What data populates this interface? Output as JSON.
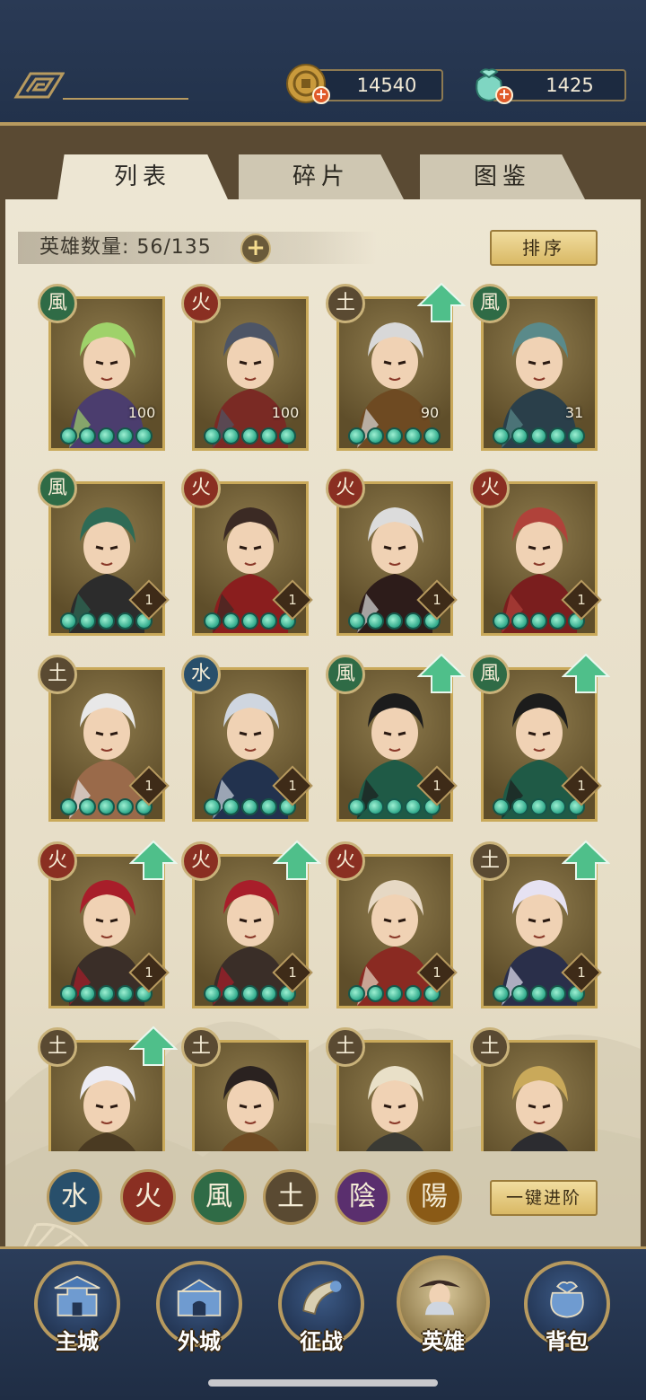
{
  "currency": {
    "coins": "14540",
    "jade": "1425"
  },
  "tabs": [
    {
      "label": "列表",
      "active": true
    },
    {
      "label": "碎片",
      "active": false
    },
    {
      "label": "图鉴",
      "active": false
    }
  ],
  "hero_count_label": "英雄数量: 56/135",
  "sort_button": "排序",
  "advance_button": "一键进阶",
  "heroes": [
    {
      "element": "風",
      "level": "100",
      "level_style": "plain",
      "upgrade": false,
      "palette": [
        "#4b3d6e",
        "#9fd26a"
      ]
    },
    {
      "element": "火",
      "level": "100",
      "level_style": "plain",
      "upgrade": false,
      "palette": [
        "#7a2a24",
        "#4d5566"
      ]
    },
    {
      "element": "土",
      "level": "90",
      "level_style": "plain",
      "upgrade": true,
      "palette": [
        "#6e4a22",
        "#d8d8d8"
      ]
    },
    {
      "element": "風",
      "level": "31",
      "level_style": "plain",
      "upgrade": false,
      "palette": [
        "#2a3f4a",
        "#5a8a8a"
      ]
    },
    {
      "element": "風",
      "level": "1",
      "level_style": "badge",
      "upgrade": false,
      "palette": [
        "#2c2c2c",
        "#2e6b56"
      ]
    },
    {
      "element": "火",
      "level": "1",
      "level_style": "badge",
      "upgrade": false,
      "palette": [
        "#8a1e1e",
        "#3b2a24"
      ]
    },
    {
      "element": "火",
      "level": "1",
      "level_style": "badge",
      "upgrade": false,
      "palette": [
        "#2d1c1a",
        "#dcdcdc"
      ]
    },
    {
      "element": "火",
      "level": "1",
      "level_style": "badge",
      "upgrade": false,
      "palette": [
        "#7a1e1e",
        "#b0423a"
      ]
    },
    {
      "element": "土",
      "level": "1",
      "level_style": "badge",
      "upgrade": false,
      "palette": [
        "#9a6a4a",
        "#e8e8e8"
      ]
    },
    {
      "element": "水",
      "level": "1",
      "level_style": "badge",
      "upgrade": false,
      "palette": [
        "#22324e",
        "#cfd6e0"
      ]
    },
    {
      "element": "風",
      "level": "1",
      "level_style": "badge",
      "upgrade": true,
      "palette": [
        "#1f5a46",
        "#1c1c1c"
      ]
    },
    {
      "element": "風",
      "level": "1",
      "level_style": "badge",
      "upgrade": true,
      "palette": [
        "#1f5a46",
        "#1c1c1c"
      ]
    },
    {
      "element": "火",
      "level": "1",
      "level_style": "badge",
      "upgrade": true,
      "palette": [
        "#3a2e28",
        "#a81e2a"
      ]
    },
    {
      "element": "火",
      "level": "1",
      "level_style": "badge",
      "upgrade": true,
      "palette": [
        "#3a2e28",
        "#a81e2a"
      ]
    },
    {
      "element": "火",
      "level": "1",
      "level_style": "badge",
      "upgrade": false,
      "palette": [
        "#8a2a22",
        "#e6d8c4"
      ]
    },
    {
      "element": "土",
      "level": "1",
      "level_style": "badge",
      "upgrade": true,
      "palette": [
        "#2a2f4a",
        "#e6e2f2"
      ]
    },
    {
      "element": "土",
      "level": "",
      "level_style": "none",
      "upgrade": true,
      "palette": [
        "#4a3a22",
        "#ecebf2"
      ]
    },
    {
      "element": "土",
      "level": "",
      "level_style": "none",
      "upgrade": false,
      "palette": [
        "#6e4a22",
        "#2a2220"
      ]
    },
    {
      "element": "土",
      "level": "",
      "level_style": "none",
      "upgrade": false,
      "palette": [
        "#3a3a34",
        "#e9e0c8"
      ]
    },
    {
      "element": "土",
      "level": "",
      "level_style": "none",
      "upgrade": false,
      "palette": [
        "#2c2c30",
        "#c9a95a"
      ]
    }
  ],
  "filters": [
    {
      "label": "水",
      "color": "#284f6b"
    },
    {
      "label": "火",
      "color": "#8a2f22"
    },
    {
      "label": "風",
      "color": "#2f6b46"
    },
    {
      "label": "土",
      "color": "#5a4a32"
    },
    {
      "label": "陰",
      "color": "#5a2f6e"
    },
    {
      "label": "陽",
      "color": "#8a5a16"
    }
  ],
  "nav": [
    {
      "label": "主城",
      "icon": "castle-icon",
      "active": false
    },
    {
      "label": "外城",
      "icon": "city-gate-icon",
      "active": false
    },
    {
      "label": "征战",
      "icon": "horn-icon",
      "active": false
    },
    {
      "label": "英雄",
      "icon": "hero-portrait-icon",
      "active": true
    },
    {
      "label": "背包",
      "icon": "bag-icon",
      "active": false
    }
  ]
}
